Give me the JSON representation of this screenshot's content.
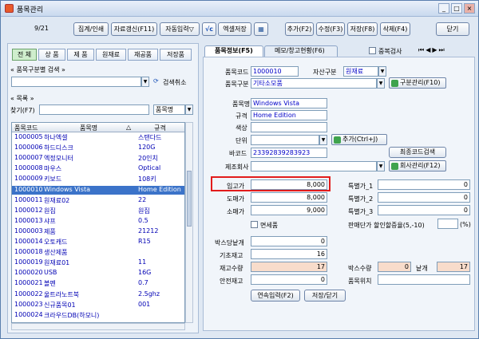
{
  "window": {
    "title": "품목관리"
  },
  "toolbar": {
    "counter": "9/21",
    "btn_print": "집계/인쇄",
    "btn_recalc": "자료갱신(F11)",
    "btn_autoinput": "자동입력▽",
    "btn_excel": "엑셀저장",
    "btn_add": "추가(F2)",
    "btn_edit": "수정(F3)",
    "btn_save": "저장(F8)",
    "btn_delete": "삭제(F4)",
    "btn_close": "닫기"
  },
  "categories": [
    "전 체",
    "상 품",
    "제 품",
    "원재료",
    "재공품",
    "저장품"
  ],
  "search": {
    "section_label": "품목구분별 검색",
    "clear_label": "검색취소"
  },
  "list": {
    "section_label": "목록",
    "find_label": "찾기(F7)",
    "find_field": "품목명",
    "columns": [
      "품목코드",
      "품목명",
      "규격"
    ],
    "sort_glyph": "△",
    "rows": [
      {
        "code": "1000005",
        "name": "하나엑셀",
        "spec": "스탠다드"
      },
      {
        "code": "1000006",
        "name": "하드디스크",
        "spec": "120G"
      },
      {
        "code": "1000007",
        "name": "엑정모니터",
        "spec": "20인치"
      },
      {
        "code": "1000008",
        "name": "마우스",
        "spec": "Optical"
      },
      {
        "code": "1000009",
        "name": "키보드",
        "spec": "108키"
      },
      {
        "code": "1000010",
        "name": "Windows Vista",
        "spec": "Home Edition"
      },
      {
        "code": "1000011",
        "name": "원재료02",
        "spec": "22"
      },
      {
        "code": "1000012",
        "name": "원집",
        "spec": "원집"
      },
      {
        "code": "1000013",
        "name": "샤프",
        "spec": "0.5"
      },
      {
        "code": "1000003",
        "name": "제품",
        "spec": "21212"
      },
      {
        "code": "1000014",
        "name": "오토캐드",
        "spec": "R15"
      },
      {
        "code": "1000018",
        "name": "생산제품",
        "spec": ""
      },
      {
        "code": "1000019",
        "name": "원재료01",
        "spec": "11"
      },
      {
        "code": "1000020",
        "name": "USB",
        "spec": "16G"
      },
      {
        "code": "1000021",
        "name": "볼펜",
        "spec": "0.7"
      },
      {
        "code": "1000022",
        "name": "울트라노트북",
        "spec": "2.5ghz"
      },
      {
        "code": "1000023",
        "name": "신규품목01",
        "spec": "001"
      },
      {
        "code": "1000024",
        "name": "크라우드DB(하모니)",
        "spec": ""
      }
    ],
    "selected_index": 5
  },
  "tabs": {
    "info": "품목정보(F5)",
    "memo": "메모/창고현황(F6)"
  },
  "dup_check": "중복검사",
  "form": {
    "code_label": "품목코드",
    "code": "1000010",
    "asset_label": "자산구분",
    "asset": "원재료",
    "group_label": "품목구분",
    "group": "기타소모품",
    "group_btn": "구분관리(F10)",
    "name_label": "품목명",
    "name": "Windows Vista",
    "spec_label": "규격",
    "spec": "Home Edition",
    "color_label": "색상",
    "color": "",
    "unit_label": "단위",
    "unit": "",
    "unit_btn": "추가(Ctrl+J)",
    "barcode_label": "바코드",
    "barcode": "23392839283923",
    "barcode_btn": "최종코드검색",
    "maker_label": "제조회사",
    "maker": "",
    "maker_btn": "회사관리(F12)",
    "in_price_label": "입고가",
    "in_price": "8,000",
    "wholesale_label": "도매가",
    "wholesale": "8,000",
    "retail_label": "소매가",
    "retail": "9,000",
    "tax_free_label": "면세품",
    "sp1_label": "특별가_1",
    "sp1": "0",
    "sp2_label": "특별가_2",
    "sp2": "0",
    "sp3_label": "특별가_3",
    "sp3": "0",
    "discount_label": "판매단가 할인할증율(5,-10)",
    "discount_unit": "(%)",
    "box_qty_label": "박스당낱개",
    "box_qty": "0",
    "base_stock_label": "기초재고",
    "base_stock": "16",
    "stock_label": "재고수량",
    "stock": "17",
    "box_count_label": "박스수량",
    "box_count": "0",
    "piece_label": "낱개",
    "piece": "17",
    "safe_stock_label": "안전재고",
    "safe_stock": "0",
    "location_label": "품목위치",
    "location": "",
    "btn_continue": "연속입력(F2)",
    "btn_save_close": "저장/닫기"
  }
}
